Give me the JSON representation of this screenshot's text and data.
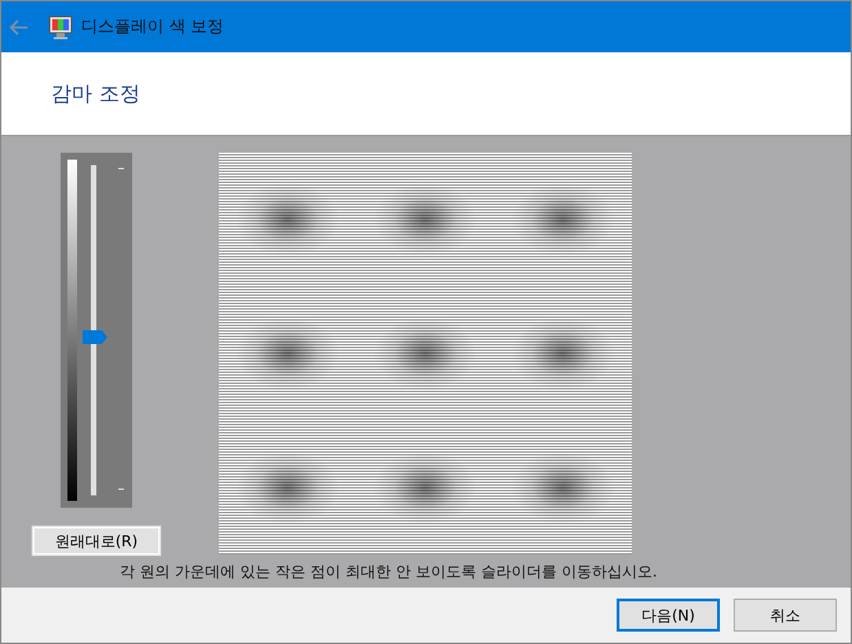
{
  "window": {
    "title": "디스플레이 색 보정"
  },
  "header": {
    "title": "감마 조정"
  },
  "gamma_slider": {
    "level": 0.48
  },
  "reset_button": {
    "label": "원래대로(R)"
  },
  "instruction": "각 원의 가운데에 있는 작은 점이 최대한 안 보이도록 슬라이더를 이동하십시오.",
  "buttons": [
    {
      "label": "다음(N)",
      "kind": "default"
    },
    {
      "label": "취소",
      "kind": "normal"
    }
  ]
}
